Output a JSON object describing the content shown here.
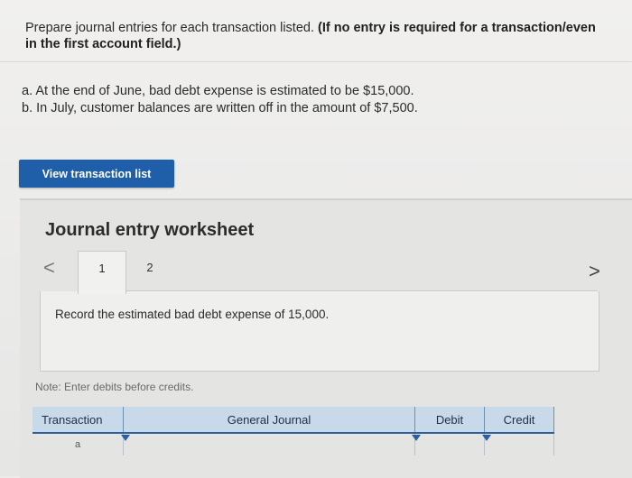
{
  "instructions": {
    "text": "Prepare journal entries for each transaction listed.",
    "bold_text": "(If no entry is required for a transaction/even",
    "bold_text_2": "in the first account field.)"
  },
  "transactions": [
    "a. At the end of June, bad debt expense is estimated to be $15,000.",
    "b. In July, customer balances are written off in the amount of $7,500."
  ],
  "view_button": "View transaction list",
  "worksheet": {
    "title": "Journal entry worksheet",
    "tabs": [
      "1",
      "2"
    ],
    "active_tab": "1",
    "prev_label": "<",
    "next_label": ">",
    "record_text": "Record the estimated bad debt expense of 15,000.",
    "note": "Note: Enter debits before credits.",
    "columns": [
      "Transaction",
      "General Journal",
      "Debit",
      "Credit"
    ],
    "first_row_transaction": "a"
  }
}
